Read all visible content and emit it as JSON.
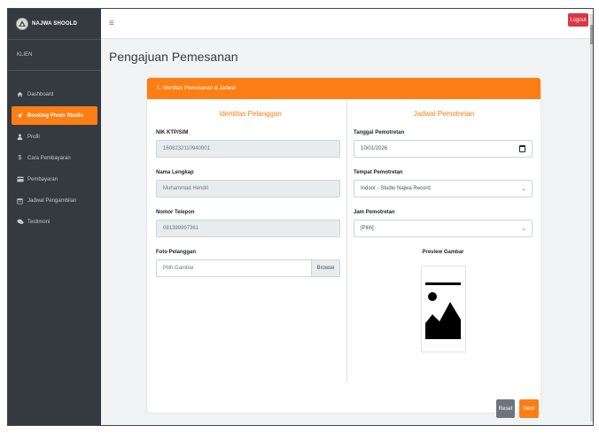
{
  "brand": {
    "name": "NAJWA SHOOLD"
  },
  "user_panel": {
    "label": "KLIEN"
  },
  "sidebar": {
    "items": [
      {
        "label": "Dashboard",
        "icon": "home-icon"
      },
      {
        "label": "Booking Photo Studio",
        "icon": "send-icon",
        "active": true
      },
      {
        "label": "Profil",
        "icon": "user-icon"
      },
      {
        "label": "Cara Pembayaran",
        "icon": "dollar-icon"
      },
      {
        "label": "Pembayaran",
        "icon": "credit-card-icon"
      },
      {
        "label": "Jadwal Pengambilan",
        "icon": "calendar-icon"
      },
      {
        "label": "Testimoni",
        "icon": "comments-icon"
      }
    ]
  },
  "topbar": {
    "menu_icon": "≡",
    "logout_label": "Logout"
  },
  "page": {
    "title": "Pengajuan Pemesanan"
  },
  "card": {
    "header": "1. Identitas Pemesanan & Jadwal"
  },
  "customer": {
    "section_title": "Identitas Pelanggan",
    "nik_label": "NIK KTP/SIM",
    "nik_value": "1608232110940001",
    "name_label": "Nama Lengkap",
    "name_value": "Muhammad Hendri",
    "phone_label": "Nomor Telepon",
    "phone_value": "081399997361",
    "photo_label": "Foto Pelanggan",
    "photo_placeholder": "Pilih Gambar",
    "browse_label": "Browse"
  },
  "schedule": {
    "section_title": "Jadwal Pemotretan",
    "date_label": "Tanggal Pemotretan",
    "date_value": "10/01/2026",
    "place_label": "Tempat Pemotretan",
    "place_value": "Indoor - Studio Najwa Record",
    "time_label": "Jam Pemotretan",
    "time_value": "[Pilih]",
    "preview_label": "Preview Gambar"
  },
  "actions": {
    "reset_label": "Reset",
    "next_label": "Next"
  },
  "colors": {
    "accent": "#fd7e14",
    "sidebar": "#343a40",
    "danger": "#dc3545",
    "secondary": "#6c757d"
  }
}
